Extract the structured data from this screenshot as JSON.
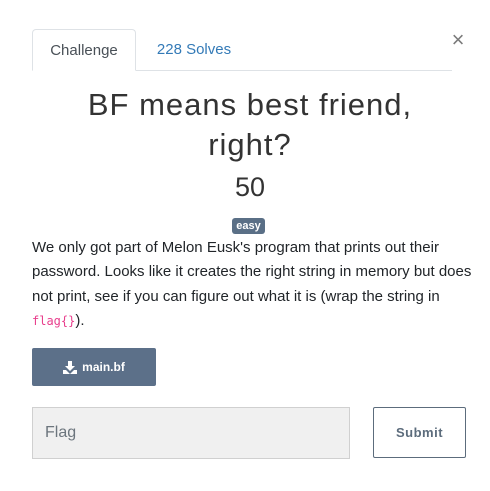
{
  "tabs": [
    {
      "label": "Challenge"
    },
    {
      "label": "228 Solves"
    }
  ],
  "close_label": "×",
  "challenge": {
    "title_line1": "BF means best friend,",
    "title_line2": "right?",
    "points": "50",
    "difficulty": "easy",
    "description_before": "We only got part of Melon Eusk's program that prints out their password. Looks like it creates the right string in memory but does not print, see if you can figure out what it is (wrap the string in ",
    "description_code": "flag{}",
    "description_after": ").",
    "file_name": "main.bf"
  },
  "form": {
    "flag_placeholder": "Flag",
    "flag_value": "",
    "submit_label": "Submit"
  },
  "colors": {
    "link": "#337ab7",
    "badge": "#5a6f86",
    "file_button": "#5c7089",
    "code": "#e83e8c"
  },
  "icons": {
    "file_button": "download-icon",
    "close": "close-icon"
  }
}
